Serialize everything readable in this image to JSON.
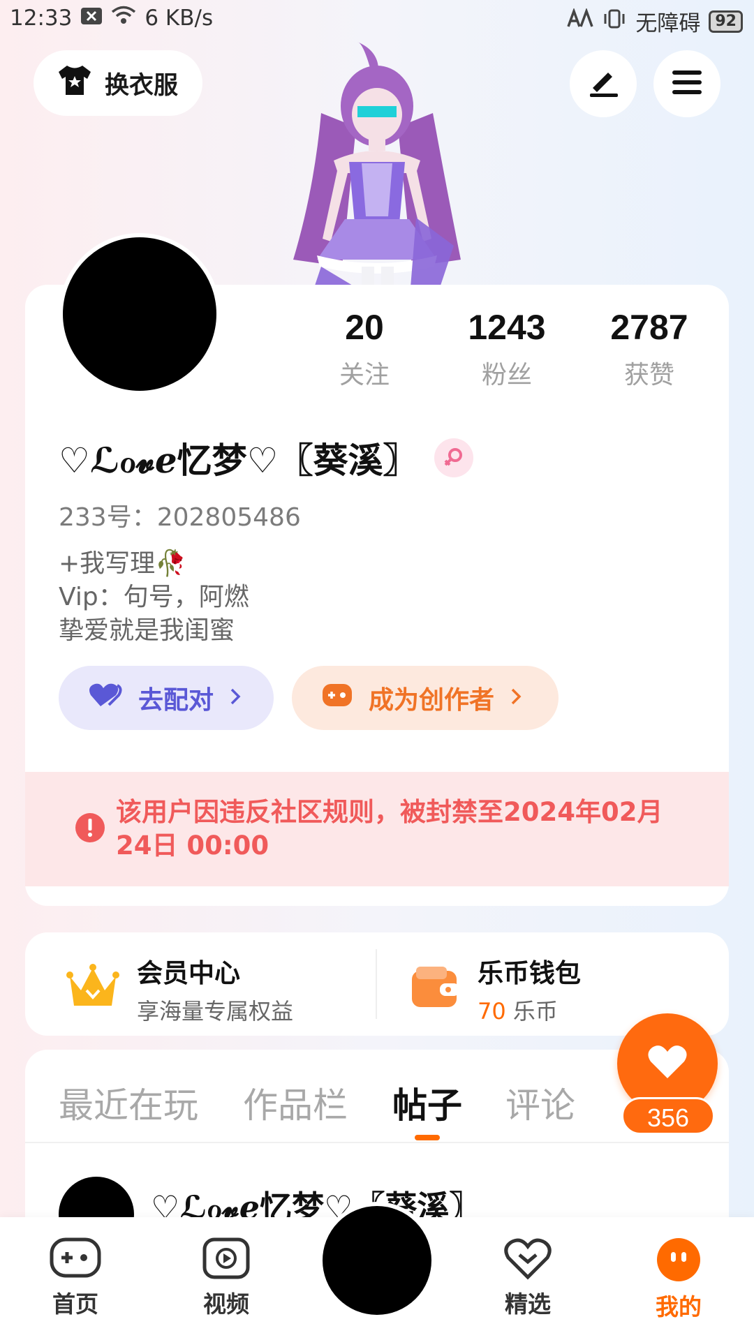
{
  "status_bar": {
    "time": "12:33",
    "net_speed": "6 KB/s",
    "accessibility": "无障碍",
    "battery": "92"
  },
  "top": {
    "outfit_label": "换衣服"
  },
  "profile": {
    "stats": [
      {
        "num": "20",
        "label": "关注"
      },
      {
        "num": "1243",
        "label": "粉丝"
      },
      {
        "num": "2787",
        "label": "获赞"
      }
    ],
    "nickname": "♡ℒℴ𝓿ℯ忆梦♡〖葵溪〗",
    "uid": "233号：202805486",
    "bio": [
      "+我写理🥀",
      "Vip：句号，阿燃",
      "挚爱就是我闺蜜"
    ],
    "match_label": "去配对",
    "creator_label": "成为创作者",
    "ban_text": "该用户因违反社区规则，被封禁至2024年02月24日 00:00"
  },
  "member": {
    "title": "会员中心",
    "sub": "享海量专属权益"
  },
  "wallet": {
    "title": "乐币钱包",
    "amount": "70",
    "unit": "乐币"
  },
  "tabs": [
    "最近在玩",
    "作品栏",
    "帖子",
    "评论"
  ],
  "post": {
    "author": "♡ℒℴ𝓿ℯ忆梦♡〖葵溪〗"
  },
  "like_count": "356",
  "nav": [
    "首页",
    "视频",
    "精选",
    "我的"
  ],
  "colors": {
    "accent": "#ff6a00",
    "match": "#5a58d6",
    "ban": "#f05a5a"
  }
}
